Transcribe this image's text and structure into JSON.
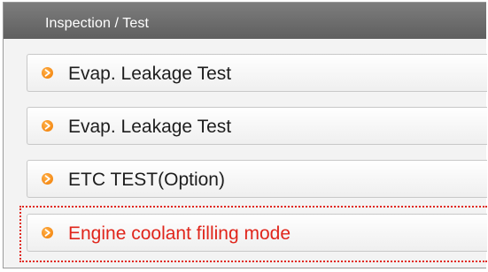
{
  "section": {
    "title": "Inspection / Test"
  },
  "items": [
    {
      "label": "Evap. Leakage Test",
      "icon": "orange-arrow-bullet-icon"
    },
    {
      "label": "Evap. Leakage Test",
      "icon": "orange-arrow-bullet-icon"
    },
    {
      "label": "ETC TEST(Option)",
      "icon": "orange-arrow-bullet-icon"
    },
    {
      "label": "Engine coolant filling mode",
      "icon": "orange-arrow-bullet-icon",
      "highlighted": true
    }
  ],
  "colors": {
    "header_bg": "#6e6e6e",
    "bullet": "#f07a00",
    "highlight": "#e0251b",
    "item_text": "#1e1e1e"
  }
}
